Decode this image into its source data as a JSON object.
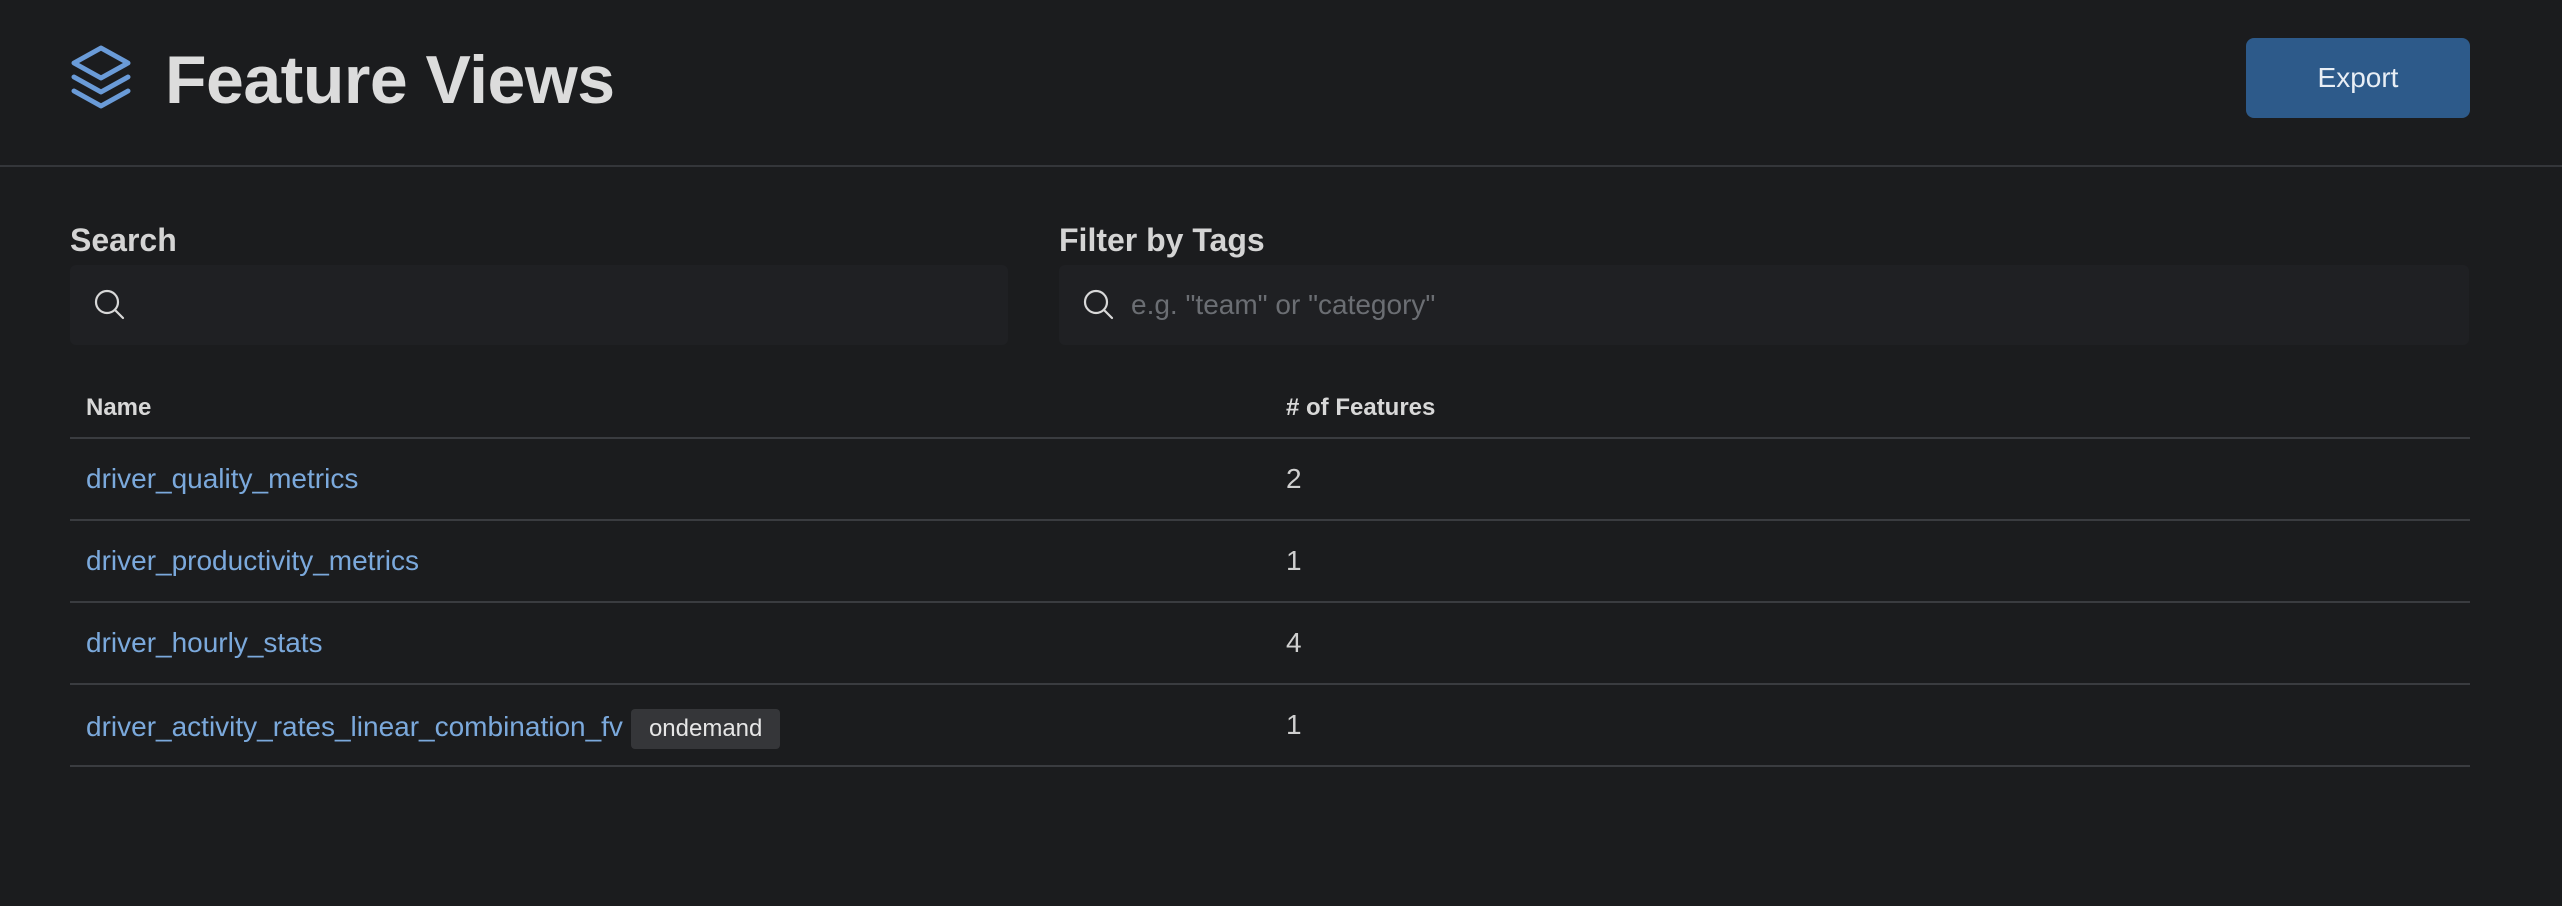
{
  "header": {
    "title": "Feature Views",
    "icon": "layers-icon",
    "export_label": "Export",
    "accent_color": "#2d5a8a",
    "icon_color": "#6a9bd8"
  },
  "filters": {
    "search": {
      "label": "Search",
      "value": "",
      "placeholder": ""
    },
    "tags": {
      "label": "Filter by Tags",
      "value": "",
      "placeholder": "e.g. \"team\" or \"category\""
    }
  },
  "table": {
    "columns": [
      "Name",
      "# of Features"
    ],
    "rows": [
      {
        "name": "driver_quality_metrics",
        "badge": "",
        "count": "2"
      },
      {
        "name": "driver_productivity_metrics",
        "badge": "",
        "count": "1"
      },
      {
        "name": "driver_hourly_stats",
        "badge": "",
        "count": "4"
      },
      {
        "name": "driver_activity_rates_linear_combination_fv",
        "badge": "ondemand",
        "count": "1"
      }
    ]
  }
}
